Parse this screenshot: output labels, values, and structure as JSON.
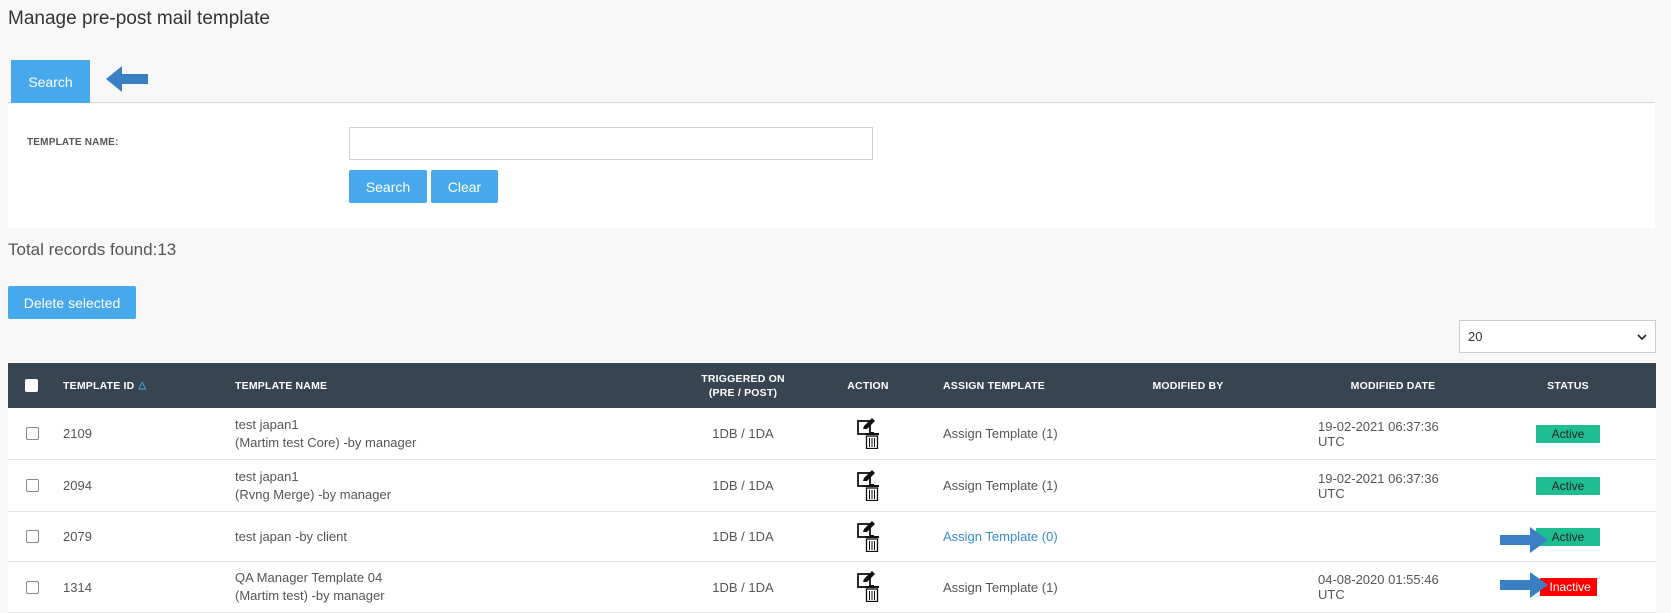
{
  "page": {
    "title": "Manage pre-post mail template"
  },
  "tabs": {
    "search_label": "Search"
  },
  "search_form": {
    "template_name_label": "TEMPLATE NAME:",
    "template_name_value": "",
    "template_name_placeholder": "",
    "search_button": "Search",
    "clear_button": "Clear"
  },
  "summary": {
    "total_label": "Total records found:",
    "total_count": "13"
  },
  "toolbar": {
    "delete_selected": "Delete selected",
    "page_size": "20"
  },
  "table": {
    "headers": {
      "template_id": "TEMPLATE ID",
      "template_name": "TEMPLATE NAME",
      "triggered_on_line1": "TRIGGERED ON",
      "triggered_on_line2": "(PRE / POST)",
      "action": "ACTION",
      "assign_template": "ASSIGN TEMPLATE",
      "modified_by": "MODIFIED BY",
      "modified_date": "MODIFIED DATE",
      "status": "STATUS"
    },
    "rows": [
      {
        "id": "2109",
        "name_line1": "test japan1",
        "name_line2": "(Martim test Core) -by manager",
        "triggered": "1DB / 1DA",
        "assign": "Assign Template (1)",
        "modified_by": "",
        "modified_date": "19-02-2021 06:37:36 UTC",
        "status": "Active"
      },
      {
        "id": "2094",
        "name_line1": "test japan1",
        "name_line2": "(Rvng Merge) -by manager",
        "triggered": "1DB / 1DA",
        "assign": "Assign Template (1)",
        "modified_by": "",
        "modified_date": "19-02-2021 06:37:36 UTC",
        "status": "Active"
      },
      {
        "id": "2079",
        "name_line1": "test japan -by client",
        "name_line2": "",
        "triggered": "1DB / 1DA",
        "assign": "Assign Template (0)",
        "modified_by": "",
        "modified_date": "",
        "status": "Active"
      },
      {
        "id": "1314",
        "name_line1": "QA Manager Template 04",
        "name_line2": "(Martim test) -by manager",
        "triggered": "1DB / 1DA",
        "assign": "Assign Template (1)",
        "modified_by": "",
        "modified_date": "04-08-2020 01:55:46 UTC",
        "status": "Inactive"
      }
    ]
  },
  "colors": {
    "primary": "#47a9ec",
    "header_bg": "#374451",
    "active": "#1fbe92",
    "inactive": "#ff0000",
    "link": "#3b8bd0",
    "annotation_arrow": "#3a7fc4"
  },
  "icons": {
    "annotation": "arrow-left-icon",
    "action_edit": "edit-icon",
    "action_delete": "trash-icon",
    "select": "chevron-down-icon"
  }
}
